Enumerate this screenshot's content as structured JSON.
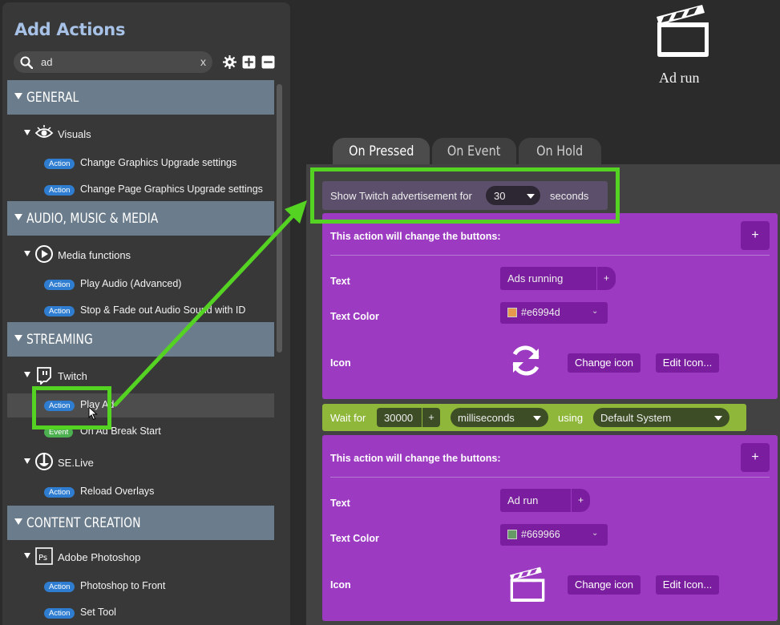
{
  "sidebar": {
    "title": "Add Actions",
    "search": {
      "value": "ad",
      "clear": "x"
    },
    "categories": [
      {
        "label": "GENERAL"
      },
      {
        "label": "AUDIO, MUSIC & MEDIA"
      },
      {
        "label": "STREAMING"
      },
      {
        "label": "CONTENT CREATION"
      }
    ],
    "groups": [
      {
        "label": "Visuals",
        "icon": "eye-icon"
      },
      {
        "label": "Media functions",
        "icon": "play-circle-icon"
      },
      {
        "label": "Twitch",
        "icon": "twitch-icon"
      },
      {
        "label": "SE.Live",
        "icon": "selive-icon"
      },
      {
        "label": "Adobe Photoshop",
        "icon": "photoshop-icon"
      }
    ],
    "items": [
      {
        "badge": "Action",
        "label": "Change Graphics Upgrade settings"
      },
      {
        "badge": "Action",
        "label": "Change Page Graphics Upgrade settings"
      },
      {
        "badge": "Action",
        "label": "Play Audio (Advanced)"
      },
      {
        "badge": "Action",
        "label": "Stop & Fade out Audio Sound with ID"
      },
      {
        "badge": "Action",
        "label": "Play Ad"
      },
      {
        "badge": "Event",
        "label": "On Ad Break Start"
      },
      {
        "badge": "Action",
        "label": "Reload Overlays"
      },
      {
        "badge": "Action",
        "label": "Photoshop to Front"
      },
      {
        "badge": "Action",
        "label": "Set Tool"
      }
    ]
  },
  "button_preview": {
    "label": "Ad run",
    "icon": "clapperboard-icon"
  },
  "tabs": [
    {
      "label": "On Pressed",
      "active": true
    },
    {
      "label": "On Event",
      "active": false
    },
    {
      "label": "On Hold",
      "active": false
    }
  ],
  "show_ad": {
    "prefix": "Show Twitch advertisement for",
    "value": "30",
    "suffix": "seconds"
  },
  "change_blocks": [
    {
      "header": "This action will change the buttons:",
      "plus": "+",
      "text_label": "Text",
      "text_value": "Ads running",
      "text_plus": "+",
      "color_label": "Text Color",
      "color_value": "#e6994d",
      "icon_label": "Icon",
      "icon": "refresh-icon",
      "change_icon": "Change icon",
      "edit_icon": "Edit Icon..."
    },
    {
      "header": "This action will change the buttons:",
      "plus": "+",
      "text_label": "Text",
      "text_value": "Ad run",
      "text_plus": "+",
      "color_label": "Text Color",
      "color_value": "#669966",
      "icon_label": "Icon",
      "icon": "clapperboard-icon",
      "change_icon": "Change icon",
      "edit_icon": "Edit Icon..."
    }
  ],
  "wait": {
    "prefix": "Wait for",
    "value": "30000",
    "plus": "+",
    "unit": "milliseconds",
    "using": "using",
    "system": "Default System"
  },
  "colors": {
    "accent_highlight": "#55d323",
    "action_badge": "#2f7dd1",
    "purple_block": "#9c3bc2",
    "wait_block": "#8fb73a",
    "category_header": "#6b7d8c"
  }
}
